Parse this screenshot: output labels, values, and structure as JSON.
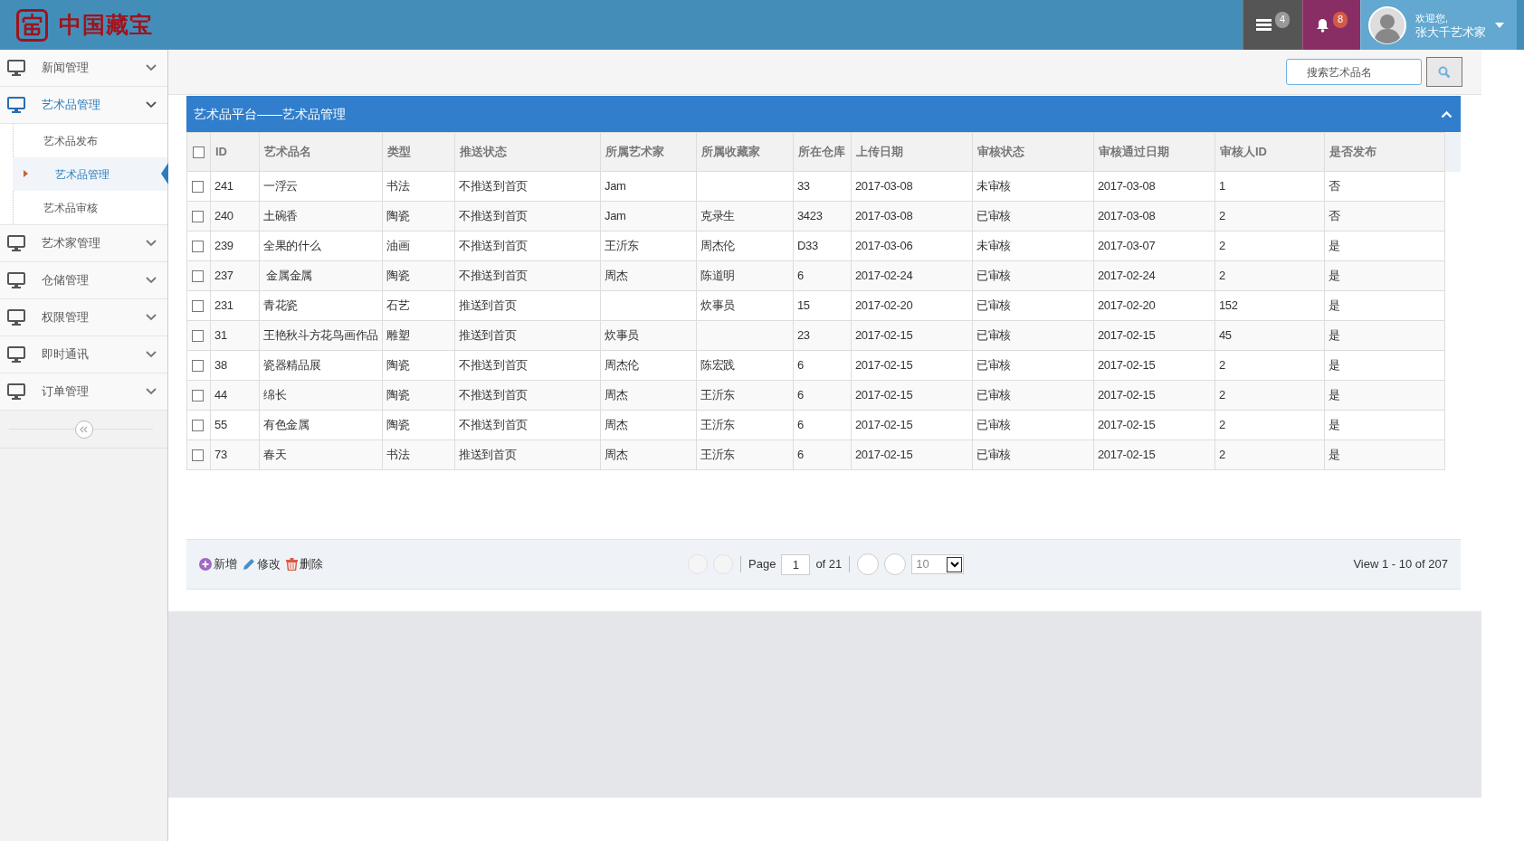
{
  "header": {
    "logo_text": "中国藏宝",
    "badges": [
      {
        "kind": "tasks",
        "count": "4"
      },
      {
        "kind": "bell",
        "count": "8"
      }
    ],
    "user": {
      "greeting": "欢迎您,",
      "name": "张大千艺术家"
    }
  },
  "sidebar": {
    "items": [
      {
        "label": "新闻管理",
        "selected": false,
        "expanded": false
      },
      {
        "label": "艺术品管理",
        "selected": true,
        "expanded": true,
        "children": [
          {
            "label": "艺术品发布",
            "selected": false
          },
          {
            "label": "艺术品管理",
            "selected": true
          },
          {
            "label": "艺术品审核",
            "selected": false
          }
        ]
      },
      {
        "label": "艺术家管理",
        "selected": false,
        "expanded": false
      },
      {
        "label": "仓储管理",
        "selected": false,
        "expanded": false
      },
      {
        "label": "权限管理",
        "selected": false,
        "expanded": false
      },
      {
        "label": "即时通讯",
        "selected": false,
        "expanded": false
      },
      {
        "label": "订单管理",
        "selected": false,
        "expanded": false
      }
    ]
  },
  "search": {
    "placeholder": "搜索艺术品名"
  },
  "panel": {
    "title": "艺术品平台——艺术品管理"
  },
  "table": {
    "select_all": false,
    "columns": [
      "ID",
      "艺术品名",
      "类型",
      "推送状态",
      "所属艺术家",
      "所属收藏家",
      "所在仓库",
      "上传日期",
      "审核状态",
      "审核通过日期",
      "审核人ID",
      "是否发布"
    ],
    "rows": [
      {
        "checked": false,
        "cells": [
          "241",
          "一浮云",
          "书法",
          "不推送到首页",
          "Jam",
          "",
          "33",
          "2017-03-08",
          "未审核",
          "2017-03-08",
          "1",
          "否"
        ]
      },
      {
        "checked": false,
        "cells": [
          "240",
          "土碗香",
          "陶瓷",
          "不推送到首页",
          "Jam",
          "克录生",
          "3423",
          "2017-03-08",
          "已审核",
          "2017-03-08",
          "2",
          "否"
        ]
      },
      {
        "checked": false,
        "cells": [
          "239",
          "全果的什么",
          "油画",
          "不推送到首页",
          "王沂东",
          "周杰伦",
          "D33",
          "2017-03-06",
          "未审核",
          "2017-03-07",
          "2",
          "是"
        ]
      },
      {
        "checked": false,
        "cells": [
          "237",
          " 金属金属",
          "陶瓷",
          "不推送到首页",
          "周杰",
          "陈道明",
          "6",
          "2017-02-24",
          "已审核",
          "2017-02-24",
          "2",
          "是"
        ]
      },
      {
        "checked": false,
        "cells": [
          "231",
          "青花瓷",
          "石艺",
          "推送到首页",
          "",
          "炊事员",
          "15",
          "2017-02-20",
          "已审核",
          "2017-02-20",
          "152",
          "是"
        ]
      },
      {
        "checked": false,
        "cells": [
          "31",
          "王艳秋斗方花鸟画作品",
          "雕塑",
          "推送到首页",
          "炊事员",
          "",
          "23",
          "2017-02-15",
          "已审核",
          "2017-02-15",
          "45",
          "是"
        ]
      },
      {
        "checked": false,
        "cells": [
          "38",
          "瓷器精品展",
          "陶瓷",
          "不推送到首页",
          "周杰伦",
          "陈宏践",
          "6",
          "2017-02-15",
          "已审核",
          "2017-02-15",
          "2",
          "是"
        ]
      },
      {
        "checked": false,
        "cells": [
          "44",
          "绵长",
          "陶瓷",
          "不推送到首页",
          "周杰",
          "王沂东",
          "6",
          "2017-02-15",
          "已审核",
          "2017-02-15",
          "2",
          "是"
        ]
      },
      {
        "checked": false,
        "cells": [
          "55",
          "有色金属",
          "陶瓷",
          "不推送到首页",
          "周杰",
          "王沂东",
          "6",
          "2017-02-15",
          "已审核",
          "2017-02-15",
          "2",
          "是"
        ]
      },
      {
        "checked": false,
        "cells": [
          "73",
          "春天",
          "书法",
          "推送到首页",
          "周杰",
          "王沂东",
          "6",
          "2017-02-15",
          "已审核",
          "2017-02-15",
          "2",
          "是"
        ]
      }
    ]
  },
  "toolbar": {
    "actions": [
      {
        "kind": "add",
        "label": "新增"
      },
      {
        "kind": "edit",
        "label": "修改"
      },
      {
        "kind": "delete",
        "label": "删除"
      }
    ]
  },
  "pager": {
    "page_label": "Page",
    "page": "1",
    "of": "of 21",
    "page_size": "10",
    "view": "View 1 - 10 of 207"
  }
}
